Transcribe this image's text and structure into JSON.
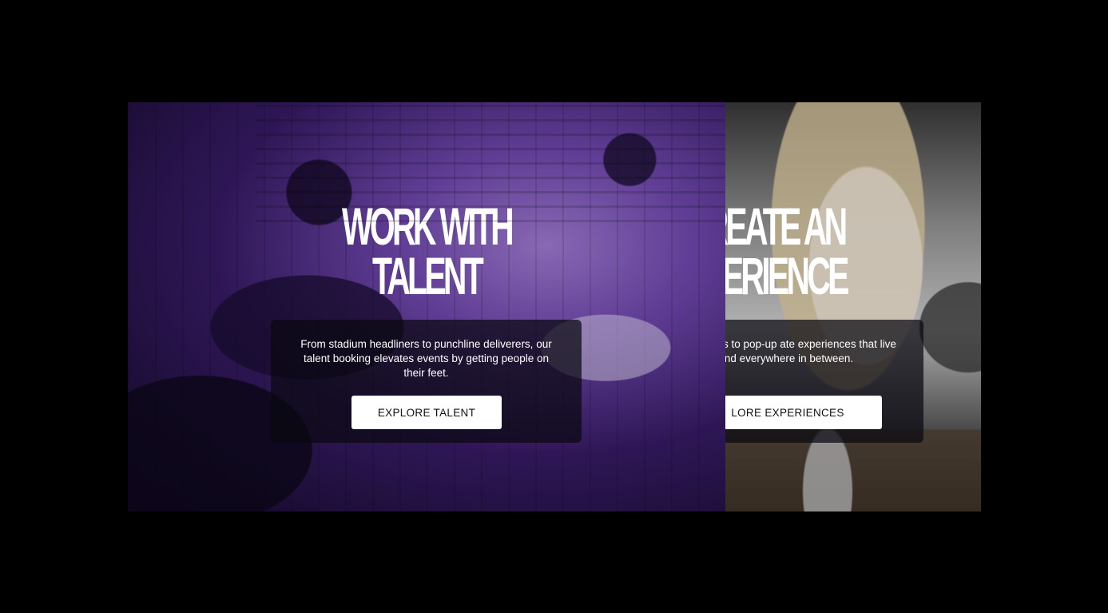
{
  "panels": [
    {
      "id": "talent",
      "headline_line1": "WORK WITH",
      "headline_line2": "TALENT",
      "description": "From stadium headliners to punchline deliverers, our talent booking elevates events by getting people on their feet.",
      "cta_label": "EXPLORE TALENT",
      "tint_color": "#8e63d2"
    },
    {
      "id": "experience",
      "headline_line1": "REATE AN",
      "headline_line2": "PERIENCE",
      "description": "festival activations to pop-up ate experiences that live online, and everywhere in between.",
      "cta_label": "LORE EXPERIENCES",
      "tint_color": "#9a9a9a"
    }
  ]
}
